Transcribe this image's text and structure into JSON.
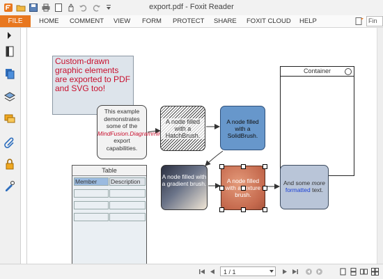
{
  "window": {
    "title": "export.pdf - Foxit Reader"
  },
  "ribbon": {
    "file_label": "FILE",
    "tabs": [
      {
        "label": "HOME"
      },
      {
        "label": "COMMENT"
      },
      {
        "label": "VIEW"
      },
      {
        "label": "FORM"
      },
      {
        "label": "PROTECT"
      },
      {
        "label": "SHARE"
      },
      {
        "label": "FOXIT CLOUD"
      },
      {
        "label": "HELP"
      }
    ],
    "find_placeholder": "Fin"
  },
  "document": {
    "note_text": "Custom-drawn graphic elements are exported to PDF and SVG too!",
    "mf_node": {
      "line1": "This example demonstrates some of the",
      "link": "MindFusion.Diagramming",
      "line2": "export capabilities."
    },
    "hatch_node": "A node filled with a HatchBrush.",
    "solid_node": "A node filled with a SolidBrush.",
    "container_title": "Container",
    "table": {
      "title": "Table",
      "columns": [
        "Member",
        "Description"
      ]
    },
    "gradient_node": "A node filled with a gradient brush.",
    "texture_node": "A node filled with a texture brush.",
    "formatted_node": {
      "part1": "And some ",
      "italic": "more",
      "blue": "formatted",
      "part2": " text."
    }
  },
  "statusbar": {
    "page": "1 / 1"
  },
  "colors": {
    "file_tab": "#e8771f",
    "solid_node": "#6797cb",
    "note_text": "#c8102e"
  }
}
